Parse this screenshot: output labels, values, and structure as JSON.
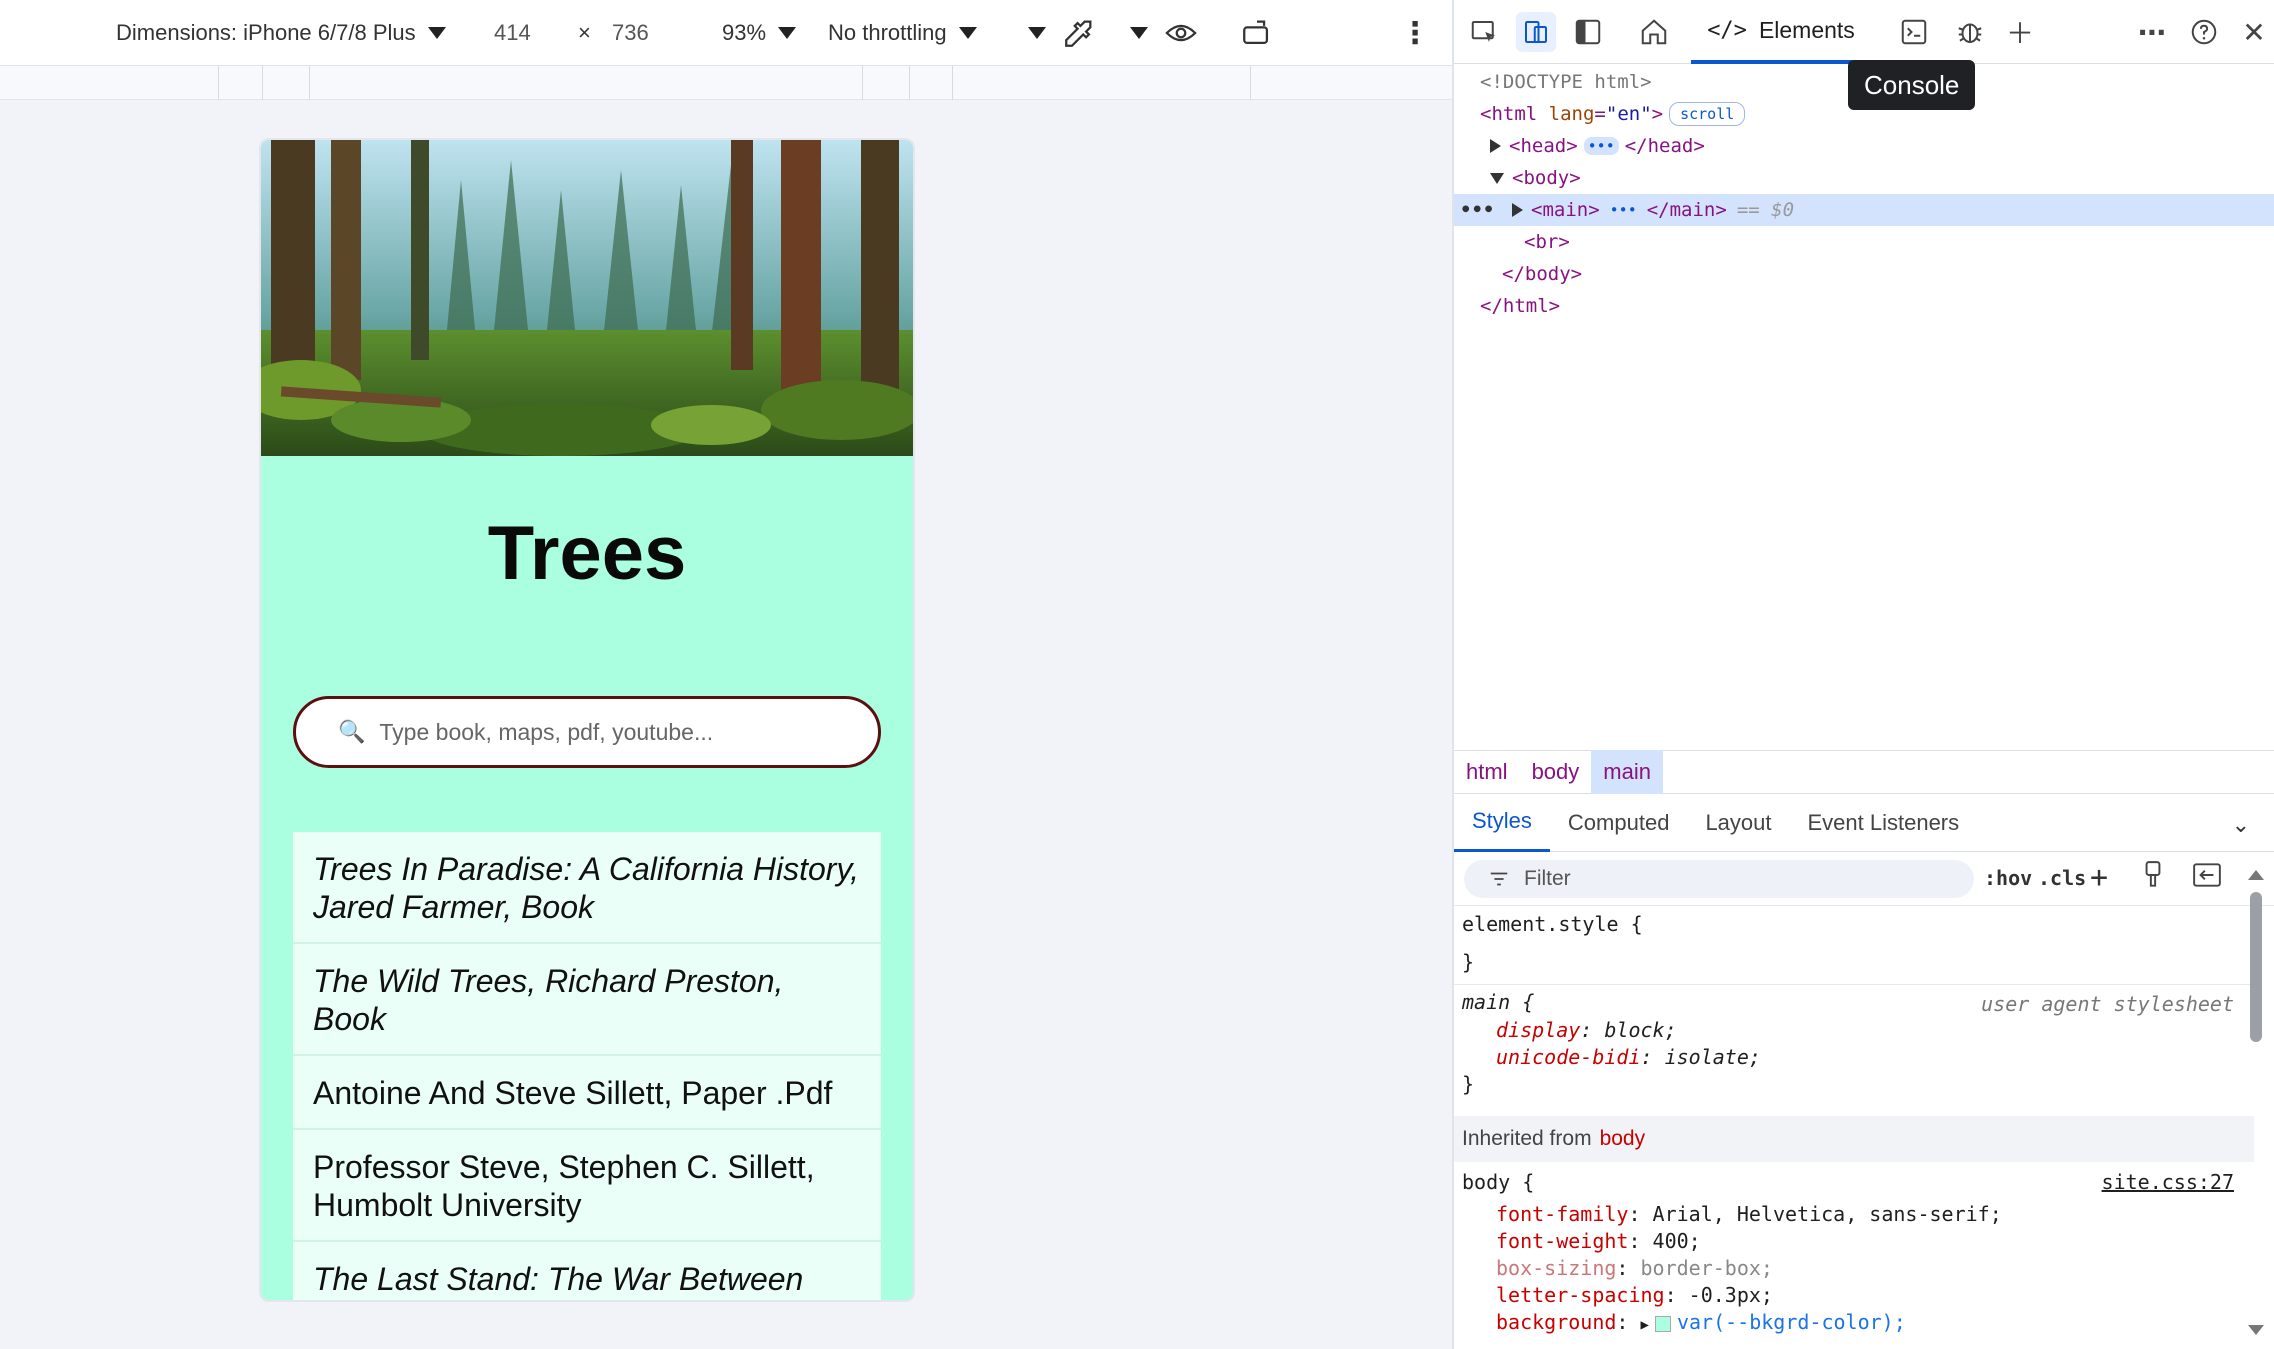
{
  "emulation": {
    "dimensions_label": "Dimensions: iPhone 6/7/8 Plus",
    "width": "414",
    "times": "×",
    "height": "736",
    "zoom": "93%",
    "throttling": "No throttling"
  },
  "page": {
    "title": "Trees",
    "search_placeholder": "Type book, maps, pdf, youtube...",
    "results": [
      {
        "text": "Trees In Paradise: A California History, Jared Farmer, Book",
        "italic": true
      },
      {
        "text": "The Wild Trees, Richard Preston, Book",
        "italic": true
      },
      {
        "text": "Antoine And Steve Sillett, Paper .Pdf",
        "italic": false
      },
      {
        "text": "Professor Steve, Stephen C. Sillett, Humbolt University",
        "italic": false
      },
      {
        "text": "The Last Stand: The War Between",
        "italic": true
      }
    ],
    "bg_color": "#aaffe0"
  },
  "devtools": {
    "elements_tab": "Elements",
    "tooltip": "Console",
    "dom": {
      "doctype": "<!DOCTYPE html>",
      "html_open": "<html",
      "lang_attr": "lang",
      "lang_val": "\"en\"",
      "scroll_badge": "scroll",
      "head_open": "<head>",
      "head_close": "</head>",
      "body_open": "<body>",
      "main_open": "<main>",
      "main_close": "</main>",
      "eq0": "== $0",
      "br": "<br>",
      "body_close": "</body>",
      "html_close": "</html>",
      "ellipsis": "•••"
    },
    "breadcrumb": [
      "html",
      "body",
      "main"
    ],
    "sub_tabs": [
      "Styles",
      "Computed",
      "Layout",
      "Event Listeners"
    ],
    "filter_placeholder": "Filter",
    "filter_hov": ":hov",
    "filter_cls": ".cls",
    "styles": {
      "element_style_open": "element.style {",
      "close_brace": "}",
      "main_sel": "main {",
      "ua_note": "user agent stylesheet",
      "main_props": [
        {
          "name": "display",
          "value": "block;"
        },
        {
          "name": "unicode-bidi",
          "value": "isolate;"
        }
      ],
      "inherited_label": "Inherited from",
      "inherited_tag": "body",
      "body_sel": "body {",
      "body_src": "site.css:27",
      "body_props": [
        {
          "name": "font-family",
          "value": "Arial, Helvetica, sans-serif;",
          "dim": false
        },
        {
          "name": "font-weight",
          "value": "400;",
          "dim": false
        },
        {
          "name": "box-sizing",
          "value": "border-box;",
          "dim": true
        },
        {
          "name": "letter-spacing",
          "value": "-0.3px;",
          "dim": false
        }
      ],
      "background_name": "background",
      "background_var": "var(--bkgrd-color);"
    }
  }
}
